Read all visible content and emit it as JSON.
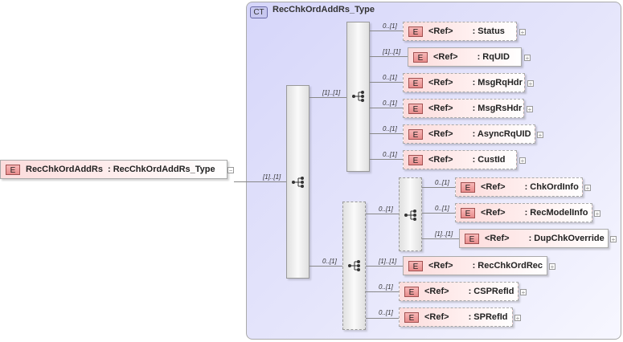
{
  "root": {
    "badge": "E",
    "name": "RecChkOrdAddRs",
    "type": ": RecChkOrdAddRs_Type",
    "cardinality": "[1]..[1]"
  },
  "complex_type": {
    "badge": "CT",
    "title": "RecChkOrdAddRs_Type"
  },
  "outer_sequence": {
    "cardinalities": [
      "[1]..[1]",
      "0..[1]"
    ]
  },
  "sequence1": {
    "elements": [
      {
        "badge": "E",
        "ref": "<Ref>",
        "name": ": Status",
        "cardinality": "0..[1]"
      },
      {
        "badge": "E",
        "ref": "<Ref>",
        "name": ": RqUID",
        "cardinality": "[1]..[1]"
      },
      {
        "badge": "E",
        "ref": "<Ref>",
        "name": ": MsgRqHdr",
        "cardinality": "0..[1]"
      },
      {
        "badge": "E",
        "ref": "<Ref>",
        "name": ": MsgRsHdr",
        "cardinality": "0..[1]"
      },
      {
        "badge": "E",
        "ref": "<Ref>",
        "name": ": AsyncRqUID",
        "cardinality": "0..[1]"
      },
      {
        "badge": "E",
        "ref": "<Ref>",
        "name": ": CustId",
        "cardinality": "0..[1]"
      }
    ]
  },
  "sequence2": {
    "inner_cardinality": "0..[1]",
    "inner_elements": [
      {
        "badge": "E",
        "ref": "<Ref>",
        "name": ": ChkOrdInfo",
        "cardinality": "0..[1]"
      },
      {
        "badge": "E",
        "ref": "<Ref>",
        "name": ": RecModelInfo",
        "cardinality": "0..[1]"
      },
      {
        "badge": "E",
        "ref": "<Ref>",
        "name": ": DupChkOverride",
        "cardinality": "[1]..[1]"
      }
    ],
    "elements": [
      {
        "badge": "E",
        "ref": "<Ref>",
        "name": ": RecChkOrdRec",
        "cardinality": "[1]..[1]"
      },
      {
        "badge": "E",
        "ref": "<Ref>",
        "name": ": CSPRefId",
        "cardinality": "0..[1]"
      },
      {
        "badge": "E",
        "ref": "<Ref>",
        "name": ": SPRefId",
        "cardinality": "0..[1]"
      }
    ]
  }
}
